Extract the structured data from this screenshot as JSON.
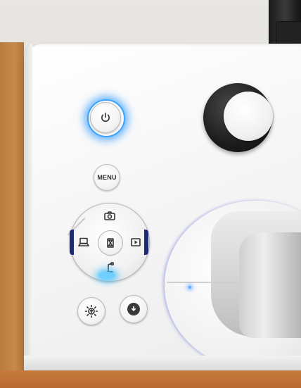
{
  "controls": {
    "menu_label": "MENU"
  },
  "status": {
    "power_led_color": "#38a3ff",
    "dpad_led_color": "#6fd0ff"
  },
  "icons": {
    "power": "power-icon",
    "camera": "camera-icon",
    "pc_source": "laptop-icon",
    "freeze": "hourglass-icon",
    "playback": "playback-icon",
    "document_camera": "document-camera-icon",
    "lamp": "lamp-brightness-icon",
    "download": "download-icon"
  }
}
